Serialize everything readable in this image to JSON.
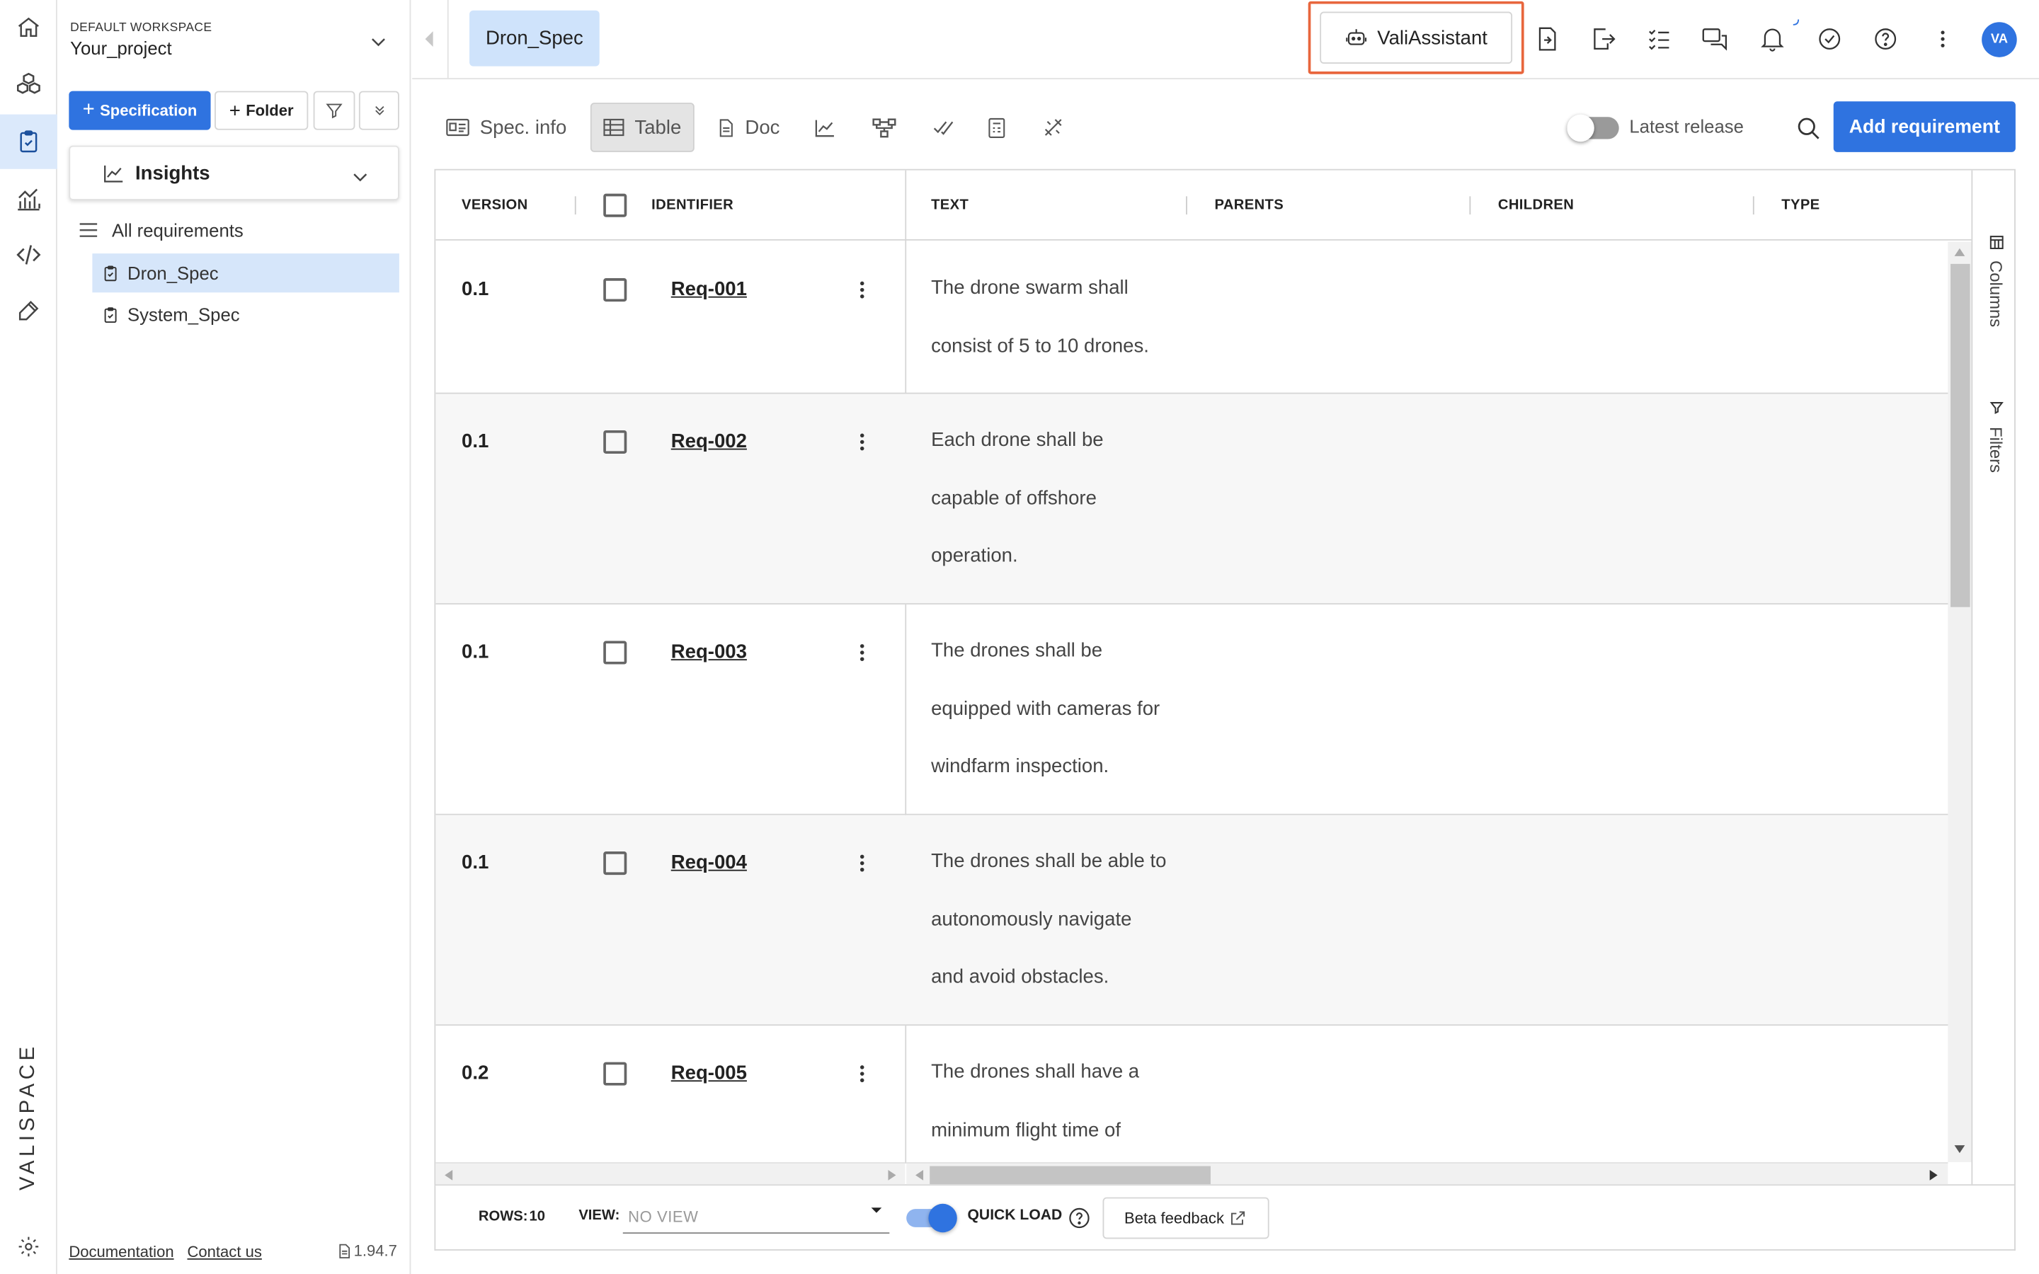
{
  "workspace": {
    "label": "DEFAULT WORKSPACE",
    "project": "Your_project"
  },
  "sidebar": {
    "specification_button": "Specification",
    "folder_button": "Folder",
    "insights_label": "Insights",
    "all_requirements": "All requirements",
    "items": [
      {
        "label": "Dron_Spec",
        "selected": true
      },
      {
        "label": "System_Spec",
        "selected": false
      }
    ],
    "footer": {
      "documentation": "Documentation",
      "contact": "Contact us",
      "version": "1.94.7"
    }
  },
  "topbar": {
    "tab": "Dron_Spec",
    "assistant": "ValiAssistant",
    "avatar": "VA"
  },
  "toolbar": {
    "spec_info": "Spec. info",
    "table": "Table",
    "doc": "Doc",
    "latest_release": "Latest release",
    "add_requirement": "Add requirement"
  },
  "table": {
    "headers": {
      "version": "VERSION",
      "identifier": "IDENTIFIER",
      "text": "TEXT",
      "parents": "PARENTS",
      "children": "CHILDREN",
      "type": "TYPE"
    },
    "rows": [
      {
        "version": "0.1",
        "id": "Req-001",
        "lines": [
          "The drone swarm shall",
          "consist of 5 to 10 drones."
        ]
      },
      {
        "version": "0.1",
        "id": "Req-002",
        "lines": [
          "Each drone shall be",
          "capable of offshore",
          "operation."
        ]
      },
      {
        "version": "0.1",
        "id": "Req-003",
        "lines": [
          "The drones shall be",
          "equipped with cameras for",
          "windfarm inspection."
        ]
      },
      {
        "version": "0.1",
        "id": "Req-004",
        "lines": [
          "The drones shall be able to",
          "autonomously navigate",
          "and avoid obstacles."
        ]
      },
      {
        "version": "0.2",
        "id": "Req-005",
        "lines": [
          "The drones shall have a",
          "minimum flight time of"
        ]
      }
    ],
    "side_tabs": {
      "columns": "Columns",
      "filters": "Filters"
    }
  },
  "footer": {
    "rows_label": "ROWS:",
    "rows_value": "10",
    "view_label": "VIEW:",
    "view_value": "NO VIEW",
    "quick_load": "QUICK LOAD",
    "beta_feedback": "Beta feedback"
  },
  "brand": {
    "logo_text": "VALISPACE"
  },
  "colors": {
    "accent": "#2f73e0",
    "highlight": "#e8663d",
    "selected_bg": "#d6e6fa"
  }
}
